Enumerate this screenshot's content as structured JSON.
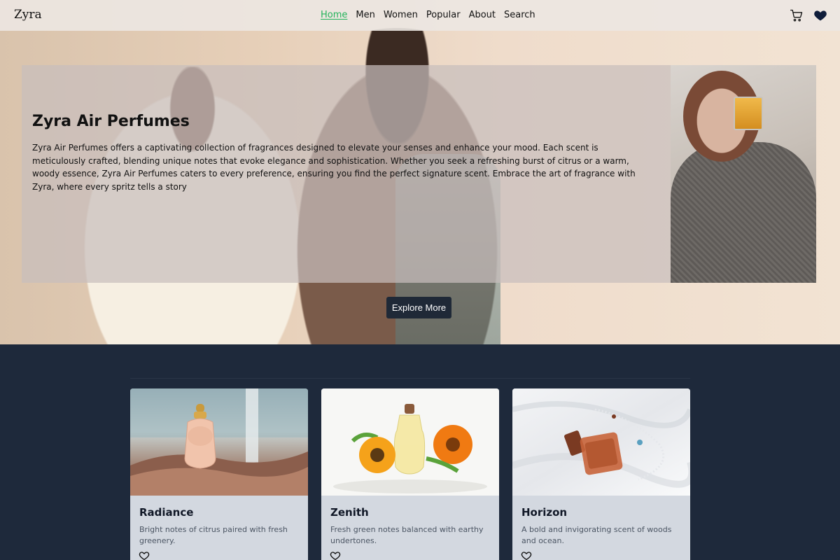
{
  "nav": {
    "brand": "Zyra",
    "links": [
      "Home",
      "Men",
      "Women",
      "Popular",
      "About",
      "Search"
    ],
    "active": "Home",
    "icons": [
      "cart-icon",
      "heart-icon"
    ]
  },
  "hero": {
    "title": "Zyra Air Perfumes",
    "description": "Zyra Air Perfumes offers a captivating collection of fragrances designed to elevate your senses and enhance your mood. Each scent is meticulously crafted, blending unique notes that evoke elegance and sophistication. Whether you seek a refreshing burst of citrus or a warm, woody essence, Zyra Air Perfumes caters to every preference, ensuring you find the perfect signature scent. Embrace the art of fragrance with Zyra, where every spritz tells a story",
    "cta": "Explore More"
  },
  "products": [
    {
      "name": "Radiance",
      "description": "Bright notes of citrus paired with fresh greenery."
    },
    {
      "name": "Zenith",
      "description": "Fresh green notes balanced with earthy undertones."
    },
    {
      "name": "Horizon",
      "description": "A bold and invigorating scent of woods and ocean."
    }
  ],
  "colors": {
    "accent": "#22b35a",
    "dark": "#1e293b",
    "button": "#1f2937",
    "card": "#d3d8e0"
  }
}
